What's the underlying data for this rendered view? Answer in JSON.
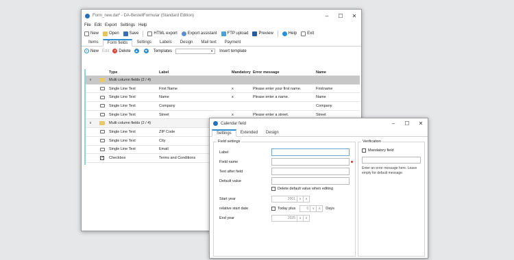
{
  "main": {
    "title": "Form_new.dat* - DA-BestellFormular (Standard Edition)",
    "menu": [
      "File",
      "Edit",
      "Export",
      "Settings",
      "Help"
    ],
    "toolbar": {
      "new": "New",
      "open": "Open",
      "save": "Save",
      "html_export": "HTML export",
      "export_assistant": "Export assistant",
      "ftp_upload": "FTP upload",
      "preview": "Preview",
      "help": "Help",
      "exit": "Exit"
    },
    "tabs": [
      "Items",
      "Form fields",
      "Settings",
      "Labels",
      "Design",
      "Mail text",
      "Payment"
    ],
    "active_tab": "Form fields",
    "subbar": {
      "new": "New",
      "edit": "Edit",
      "delete": "Delete",
      "templates_label": "Templates",
      "insert_template": "Insert template"
    },
    "grid": {
      "headers": [
        "Type",
        "Label",
        "Mandatory",
        "Error message",
        "Name"
      ],
      "group1": "Multi column fields (2 / 4)",
      "group2": "Multi column fields (2 / 4)",
      "rows_a": [
        {
          "type": "Single Line Text",
          "label": "First Name",
          "mandatory": "x",
          "error": "Please enter your first name.",
          "name": "Firstname"
        },
        {
          "type": "Single Line Text",
          "label": "Name",
          "mandatory": "x",
          "error": "Please enter a name.",
          "name": "Name"
        },
        {
          "type": "Single Line Text",
          "label": "Company",
          "mandatory": "",
          "error": "",
          "name": "Company"
        },
        {
          "type": "Single Line Text",
          "label": "Street",
          "mandatory": "x",
          "error": "Please enter a street.",
          "name": "Street"
        }
      ],
      "rows_b": [
        {
          "type": "Single Line Text",
          "label": "ZIP Code"
        },
        {
          "type": "Single Line Text",
          "label": "City"
        },
        {
          "type": "Single Line Text",
          "label": "Email"
        },
        {
          "type": "Checkbox",
          "label": "Terms and Conditions"
        }
      ]
    }
  },
  "calendar": {
    "title": "Calendar field",
    "tabs": [
      "Settings",
      "Extended",
      "Design"
    ],
    "field_settings": "Field settings",
    "fields": {
      "label": "Label",
      "field_name": "Field name",
      "text_after": "Text after field",
      "default_value": "Default value",
      "delete_default": "Delete default value when editing",
      "start_year": "Start year",
      "start_year_value": "2001",
      "relative_start_date": "relative start date",
      "today_plus": "Today plus",
      "today_plus_value": "0",
      "days": "Days",
      "end_year": "End year",
      "end_year_value": "2025"
    },
    "verification": {
      "title": "Verification",
      "mandatory_field": "Mandatory field",
      "hint": "Enter an error message here. Leave empty for default message."
    }
  },
  "colors": {
    "accent": "#2a8fd4",
    "group_row": "#c7c7c7",
    "grid_edge": "#8fd3de",
    "required_dot": "#d03030"
  }
}
